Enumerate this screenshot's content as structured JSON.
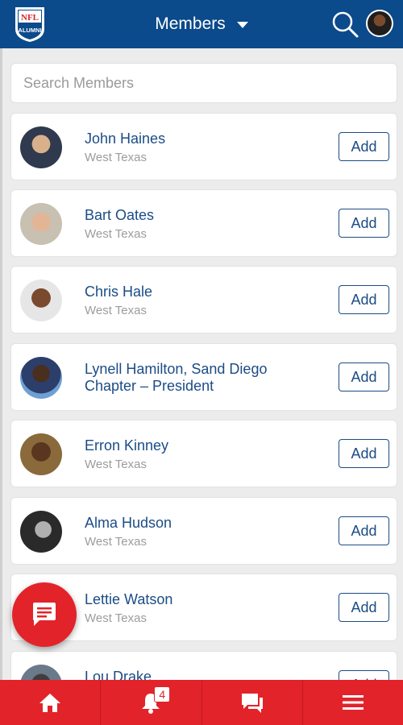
{
  "header": {
    "title": "Members",
    "logo_text_top": "NFL",
    "logo_text_bottom": "ALUMNI"
  },
  "search": {
    "placeholder": "Search Members"
  },
  "members": [
    {
      "name": "John Haines",
      "location": "West Texas",
      "action": "Add"
    },
    {
      "name": "Bart Oates",
      "location": "West Texas",
      "action": "Add"
    },
    {
      "name": "Chris Hale",
      "location": "West Texas",
      "action": "Add"
    },
    {
      "name": "Lynell Hamilton, Sand Diego Chapter – President",
      "location": "",
      "action": "Add"
    },
    {
      "name": "Erron Kinney",
      "location": "West Texas",
      "action": "Add"
    },
    {
      "name": "Alma Hudson",
      "location": "West Texas",
      "action": "Add"
    },
    {
      "name": "Lettie Watson",
      "location": "West Texas",
      "action": "Add"
    },
    {
      "name": "Lou Drake",
      "location": "",
      "action": "Add"
    }
  ],
  "bottom_nav": {
    "items": [
      {
        "icon": "home-icon"
      },
      {
        "icon": "bell-icon",
        "badge": "4"
      },
      {
        "icon": "chat-icon"
      },
      {
        "icon": "menu-icon"
      }
    ]
  },
  "fab": {
    "icon": "message-icon"
  },
  "colors": {
    "header_bg": "#0b4a8b",
    "accent_red": "#e2232a",
    "name_blue": "#1b4c86",
    "page_bg": "#ececec"
  }
}
